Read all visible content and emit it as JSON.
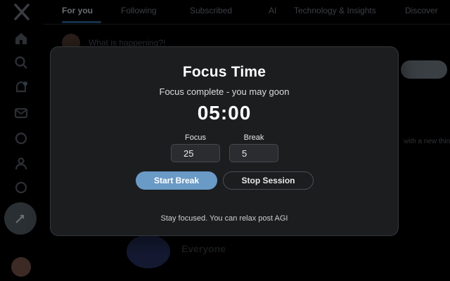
{
  "background": {
    "tabs": [
      "For you",
      "Following",
      "Subscribed",
      "AI",
      "Technology & Insights",
      "Discover"
    ],
    "compose_placeholder": "What is happening?!",
    "side_text": "with a new thing to say.",
    "bottom_label": "Everyone"
  },
  "modal": {
    "title": "Focus Time",
    "status": "Focus complete - you may goon",
    "timer": "05:00",
    "focus_label": "Focus",
    "focus_value": "25",
    "break_label": "Break",
    "break_value": "5",
    "start_break_label": "Start Break",
    "stop_session_label": "Stop Session",
    "footer": "Stay focused. You can relax post AGI",
    "accent_color": "#6a9ac6"
  }
}
